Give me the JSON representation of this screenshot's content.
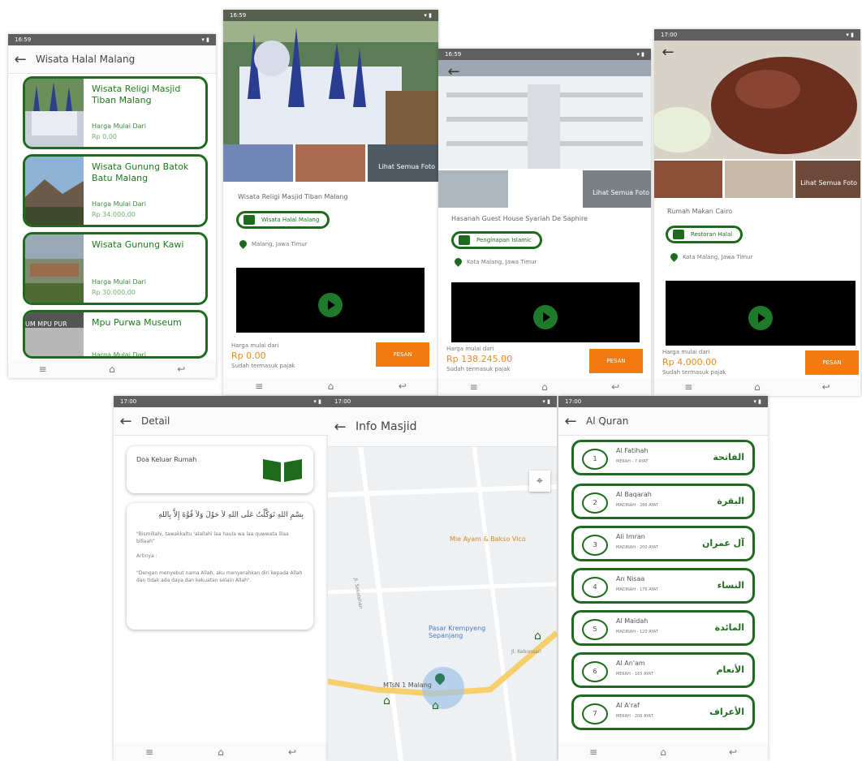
{
  "screen1": {
    "status_time": "16:59",
    "title": "Wisata Halal Malang",
    "items": [
      {
        "title": "Wisata Religi Masjid Tiban Malang",
        "price_label": "Harga Mulai Dari",
        "price": "Rp 0.00"
      },
      {
        "title": "Wisata Gunung Batok Batu Malang",
        "price_label": "Harga Mulai Dari",
        "price": "Rp 34.000.00"
      },
      {
        "title": "Wisata Gunung Kawi",
        "price_label": "Harga Mulai Dari",
        "price": "Rp 30.000.00"
      },
      {
        "title": "Mpu Purwa Museum",
        "price_label": "Harga Mulai Dari",
        "price": ""
      }
    ],
    "thumb4_text": "UM MPU PUR"
  },
  "screen2": {
    "status_time": "16:59",
    "more_photos": "Lihat Semua Foto",
    "name": "Wisata Religi Masjid Tiban Malang",
    "category": "Wisata Halal Malang",
    "location": "Malang, Jawa Timur",
    "price_label": "Harga mulai dari",
    "price": "Rp 0.00",
    "tax_note": "Sudah termasuk pajak",
    "button": "PESAN"
  },
  "screen3": {
    "status_time": "16:59",
    "more_photos": "Lihat Semua Foto",
    "name": "Hasanah Guest House Syariah De Saphire",
    "category": "Penginapan Islamic",
    "location": "Kota Malang, Jawa Timur",
    "price_label": "Harga mulai dari",
    "price": "Rp 138.245.00",
    "tax_note": "Sudah termasuk pajak",
    "button": "PESAN"
  },
  "screen4": {
    "status_time": "17:00",
    "more_photos": "Lihat Semua Foto",
    "name": "Rumah Makan Cairo",
    "category": "Restoran Halal",
    "location": "Kota Malang, Jawa Timur",
    "price_label": "Harga mulai dari",
    "price": "Rp 4.000.00",
    "tax_note": "Sudah termasuk pajak",
    "button": "PESAN"
  },
  "screen5": {
    "status_time": "17:00",
    "title": "Detail",
    "doa_title": "Doa Keluar Rumah",
    "arabic": "بِسْمِ اللهِ تَوَكَّلْتُ عَلَى اللهِ لاَ حَوْلَ وَلاَ قُوَّةَ إِلاَّ بِاللهِ",
    "latin": "\"Bismillahi, tawakkaltu 'alallahi laa haula wa laa quwwata illaa billaah\"",
    "artinya_label": "Artinya :",
    "meaning": "\"Dengan menyebut nama Allah, aku menyerahkan diri kepada Allah dan tidak ada daya dan kekuatan selain Allah\"."
  },
  "screen6": {
    "status_time": "17:00",
    "title": "Info Masjid",
    "labels": {
      "restaurant": "Mie Ayam & Bakso Vico",
      "market": "Pasar Krempyeng Sepanjang",
      "school": "MTsN 1 Malang",
      "road1": "Jl. Sekolahan",
      "road2": "Jl. Kebonsari"
    }
  },
  "screen7": {
    "status_time": "17:00",
    "title": "Al Quran",
    "surahs": [
      {
        "num": "1",
        "name": "Al Fatihah",
        "meta": "MEKAH - 7 AYAT",
        "arabic": "الفاتحة"
      },
      {
        "num": "2",
        "name": "Al Baqarah",
        "meta": "MADINAH - 286 AYAT",
        "arabic": "البقرة"
      },
      {
        "num": "3",
        "name": "Ali Imran",
        "meta": "MADINAH - 200 AYAT",
        "arabic": "آل عمران"
      },
      {
        "num": "4",
        "name": "An Nisaa",
        "meta": "MADINAH - 176 AYAT",
        "arabic": "النساء"
      },
      {
        "num": "5",
        "name": "Al Maidah",
        "meta": "MADINAH - 120 AYAT",
        "arabic": "المائدة"
      },
      {
        "num": "6",
        "name": "Al An'am",
        "meta": "MEKAH - 165 AYAT",
        "arabic": "الأنعام"
      },
      {
        "num": "7",
        "name": "Al A'raf",
        "meta": "MEKAH - 206 AYAT",
        "arabic": "الأعراف"
      }
    ]
  },
  "colors": {
    "primary_green": "#1e6b1e",
    "accent_orange": "#f47a10"
  }
}
